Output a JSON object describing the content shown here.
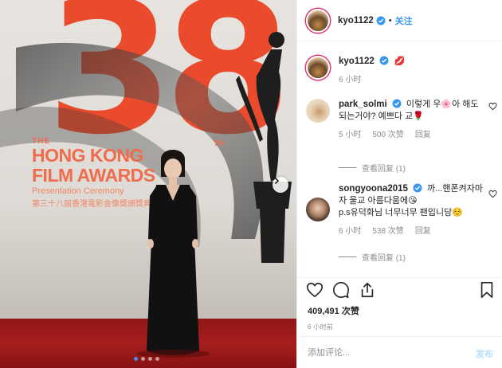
{
  "photo": {
    "background_number": "38",
    "award_the": "THE",
    "award_line1": "HONG KONG",
    "award_line2": "FILM AWARDS",
    "award_sub": "Presentation Ceremony",
    "award_cn": "第三十八屆香港電影金像獎頒獎典禮",
    "award_th": "TH",
    "carousel_dots": 4,
    "carousel_active_index": 0
  },
  "post": {
    "author": "kyo1122",
    "follow_separator": "•",
    "follow_label": "关注",
    "caption_emoji": "💋",
    "caption_time": "6 小时",
    "comments": [
      {
        "username": "park_solmi",
        "text": "이렇게 우🌸아 해도 되는거야? 예쁘다 교🌹",
        "time": "5 小时",
        "likes": "500 次赞",
        "reply_label": "回复",
        "view_replies": "查看回复 (1)"
      },
      {
        "username": "songyoona2015",
        "text": "까...핸폰켜자마자 울교 아름다움에😘\np.s유덕화님 너무너무 팬입니당☺️",
        "time": "6 小时",
        "likes": "538 次赞",
        "reply_label": "回复",
        "view_replies": "查看回复 (1)"
      }
    ],
    "like_count": "409,491 次赞",
    "post_time": "6 小时前",
    "comment_placeholder": "添加评论...",
    "post_button": "发布"
  },
  "colors": {
    "accent_blue": "#3897f0",
    "text_dark": "#262626",
    "text_muted": "#8e8e8e",
    "poster_orange": "#ea4b2c",
    "carpet_red": "#a71e1e"
  },
  "icons": [
    "verified-badge-icon",
    "heart-icon",
    "comment-icon",
    "share-icon",
    "bookmark-icon",
    "chevron-right-icon"
  ]
}
